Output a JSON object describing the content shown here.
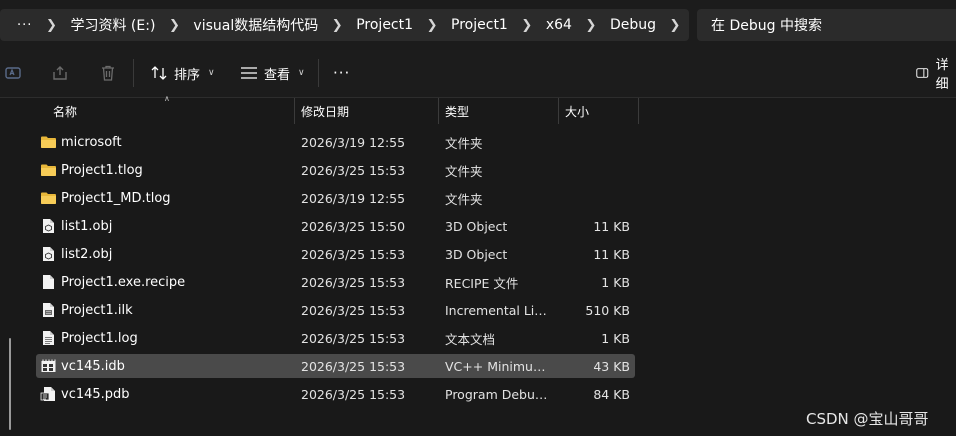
{
  "address": {
    "more_label": "···",
    "breadcrumbs": [
      {
        "label": "学习资料 (E:)"
      },
      {
        "label": "visual数据结构代码"
      },
      {
        "label": "Project1"
      },
      {
        "label": "Project1"
      },
      {
        "label": "x64"
      },
      {
        "label": "Debug"
      }
    ],
    "search_placeholder": "在 Debug 中搜索"
  },
  "toolbar": {
    "sort_label": "排序",
    "view_label": "查看",
    "more_label": "···",
    "details_label": "详细"
  },
  "columns": {
    "name": "名称",
    "date": "修改日期",
    "type": "类型",
    "size": "大小"
  },
  "files": [
    {
      "name": "microsoft",
      "date": "2026/3/19 12:55",
      "type": "文件夹",
      "size": "",
      "icon": "folder-icon"
    },
    {
      "name": "Project1.tlog",
      "date": "2026/3/25 15:53",
      "type": "文件夹",
      "size": "",
      "icon": "folder-icon"
    },
    {
      "name": "Project1_MD.tlog",
      "date": "2026/3/19 12:55",
      "type": "文件夹",
      "size": "",
      "icon": "folder-icon"
    },
    {
      "name": "list1.obj",
      "date": "2026/3/25 15:50",
      "type": "3D Object",
      "size": "11 KB",
      "icon": "object-file-icon"
    },
    {
      "name": "list2.obj",
      "date": "2026/3/25 15:53",
      "type": "3D Object",
      "size": "11 KB",
      "icon": "object-file-icon"
    },
    {
      "name": "Project1.exe.recipe",
      "date": "2026/3/25 15:53",
      "type": "RECIPE 文件",
      "size": "1 KB",
      "icon": "file-icon"
    },
    {
      "name": "Project1.ilk",
      "date": "2026/3/25 15:53",
      "type": "Incremental Link...",
      "size": "510 KB",
      "icon": "binary-file-icon"
    },
    {
      "name": "Project1.log",
      "date": "2026/3/25 15:53",
      "type": "文本文档",
      "size": "1 KB",
      "icon": "text-file-icon"
    },
    {
      "name": "vc145.idb",
      "date": "2026/3/25 15:53",
      "type": "VC++ Minimum ...",
      "size": "43 KB",
      "icon": "database-file-icon",
      "selected": true
    },
    {
      "name": "vc145.pdb",
      "date": "2026/3/25 15:53",
      "type": "Program Debug...",
      "size": "84 KB",
      "icon": "debug-file-icon"
    }
  ],
  "watermark": "CSDN @宝山哥哥"
}
